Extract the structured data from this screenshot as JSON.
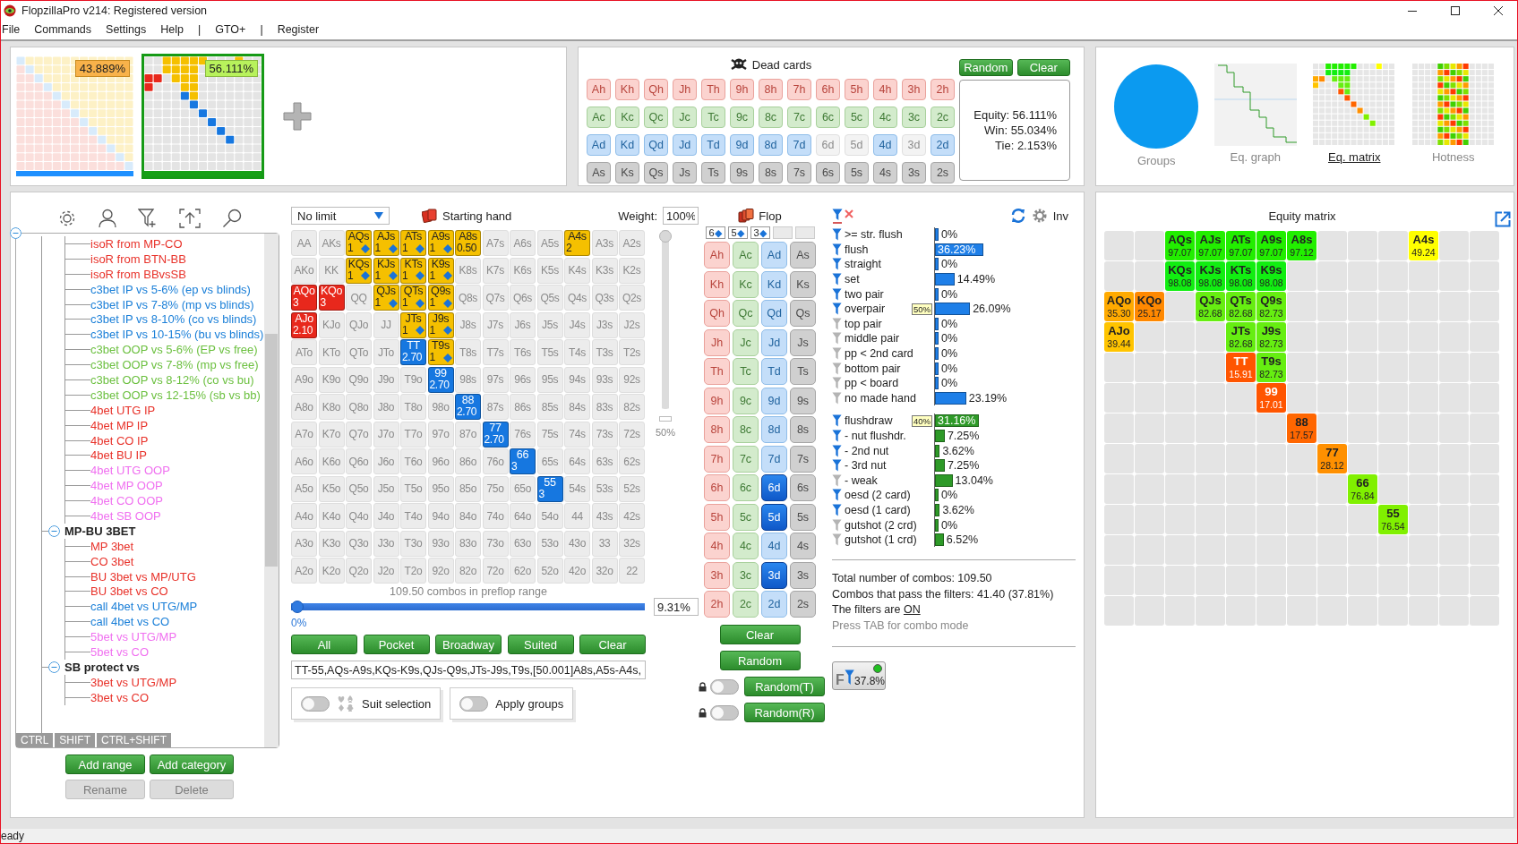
{
  "window": {
    "title": "FlopzillaPro v214: Registered version"
  },
  "menu": [
    "File",
    "Commands",
    "Settings",
    "Help",
    "|",
    "GTO+",
    "|",
    "Register"
  ],
  "ranges": [
    {
      "equity": "43.889%",
      "selected": false,
      "color": "#1e90ff"
    },
    {
      "equity": "56.111%",
      "selected": true,
      "color": "#16a016"
    }
  ],
  "dead_cards": {
    "title": "Dead cards",
    "buttons": [
      "Random",
      "Clear"
    ],
    "rows": [
      {
        "kind": "hearts",
        "cards": [
          {
            "card": "Ah",
            "disabled": false
          },
          {
            "card": "Kh",
            "disabled": false
          },
          {
            "card": "Qh",
            "disabled": false
          },
          {
            "card": "Jh",
            "disabled": false
          },
          {
            "card": "Th",
            "disabled": false
          },
          {
            "card": "9h",
            "disabled": false
          },
          {
            "card": "8h",
            "disabled": false
          },
          {
            "card": "7h",
            "disabled": false
          },
          {
            "card": "6h",
            "disabled": false
          },
          {
            "card": "5h",
            "disabled": false
          },
          {
            "card": "4h",
            "disabled": false
          },
          {
            "card": "3h",
            "disabled": false
          },
          {
            "card": "2h",
            "disabled": false
          }
        ]
      },
      {
        "kind": "clubs",
        "cards": [
          {
            "card": "Ac",
            "disabled": false
          },
          {
            "card": "Kc",
            "disabled": false
          },
          {
            "card": "Qc",
            "disabled": false
          },
          {
            "card": "Jc",
            "disabled": false
          },
          {
            "card": "Tc",
            "disabled": false
          },
          {
            "card": "9c",
            "disabled": false
          },
          {
            "card": "8c",
            "disabled": false
          },
          {
            "card": "7c",
            "disabled": false
          },
          {
            "card": "6c",
            "disabled": false
          },
          {
            "card": "5c",
            "disabled": false
          },
          {
            "card": "4c",
            "disabled": false
          },
          {
            "card": "3c",
            "disabled": false
          },
          {
            "card": "2c",
            "disabled": false
          }
        ]
      },
      {
        "kind": "diamonds",
        "cards": [
          {
            "card": "Ad",
            "disabled": false
          },
          {
            "card": "Kd",
            "disabled": false
          },
          {
            "card": "Qd",
            "disabled": false
          },
          {
            "card": "Jd",
            "disabled": false
          },
          {
            "card": "Td",
            "disabled": false
          },
          {
            "card": "9d",
            "disabled": false
          },
          {
            "card": "8d",
            "disabled": false
          },
          {
            "card": "7d",
            "disabled": false
          },
          {
            "card": "6d",
            "disabled": true
          },
          {
            "card": "5d",
            "disabled": true
          },
          {
            "card": "4d",
            "disabled": false
          },
          {
            "card": "3d",
            "disabled": true
          },
          {
            "card": "2d",
            "disabled": false
          }
        ]
      },
      {
        "kind": "spades",
        "cards": [
          {
            "card": "As",
            "disabled": false
          },
          {
            "card": "Ks",
            "disabled": false
          },
          {
            "card": "Qs",
            "disabled": false
          },
          {
            "card": "Js",
            "disabled": false
          },
          {
            "card": "Ts",
            "disabled": false
          },
          {
            "card": "9s",
            "disabled": false
          },
          {
            "card": "8s",
            "disabled": false
          },
          {
            "card": "7s",
            "disabled": false
          },
          {
            "card": "6s",
            "disabled": false
          },
          {
            "card": "5s",
            "disabled": false
          },
          {
            "card": "4s",
            "disabled": false
          },
          {
            "card": "3s",
            "disabled": false
          },
          {
            "card": "2s",
            "disabled": false
          }
        ]
      }
    ]
  },
  "equity": {
    "equity": "Equity: 56.111%",
    "win": "Win: 55.034%",
    "tie": "Tie: 2.153%"
  },
  "views": [
    {
      "label": "Groups",
      "kind": "groups",
      "selected": false
    },
    {
      "label": "Eq. graph",
      "kind": "graph",
      "selected": false
    },
    {
      "label": "Eq. matrix",
      "kind": "matrix",
      "selected": true
    },
    {
      "label": "Hotness",
      "kind": "hotness",
      "selected": false
    }
  ],
  "tree": {
    "expanded": true,
    "children": [
      {
        "children": [
          {
            "label": "isoR from MP-CO",
            "color": "#e8322a"
          },
          {
            "label": "isoR from BTN-BB",
            "color": "#e8322a"
          },
          {
            "label": "isoR from BBvsSB",
            "color": "#e8322a"
          },
          {
            "label": "c3bet IP vs 5-6% (ep vs blinds)",
            "color": "#1a7fd8"
          },
          {
            "label": "c3bet IP vs 7-8% (mp vs blinds)",
            "color": "#1a7fd8"
          },
          {
            "label": "c3bet IP vs 8-10% (co vs blinds)",
            "color": "#1a7fd8"
          },
          {
            "label": "c3bet IP vs 10-15% (bu vs blinds)",
            "color": "#1a7fd8"
          },
          {
            "label": "c3bet OOP vs 5-6% (EP vs free)",
            "color": "#6cc040"
          },
          {
            "label": "c3bet OOP vs 7-8% (mp vs free)",
            "color": "#6cc040"
          },
          {
            "label": "c3bet OOP vs 8-12% (co vs bu)",
            "color": "#6cc040"
          },
          {
            "label": "c3bet OOP vs 12-15% (sb vs bb)",
            "color": "#6cc040"
          },
          {
            "label": "4bet UTG IP",
            "color": "#e8322a"
          },
          {
            "label": "4bet MP IP",
            "color": "#e8322a"
          },
          {
            "label": "4bet CO IP",
            "color": "#e8322a"
          },
          {
            "label": "4bet BU IP",
            "color": "#e8322a"
          },
          {
            "label": "4bet UTG OOP",
            "color": "#f070f0"
          },
          {
            "label": "4bet MP OOP",
            "color": "#f070f0"
          },
          {
            "label": "4bet CO OOP",
            "color": "#f070f0"
          },
          {
            "label": "4bet SB OOP",
            "color": "#f070f0"
          }
        ]
      },
      {
        "label": "MP-BU 3BET",
        "expanded": true,
        "children": [
          {
            "label": "MP 3bet",
            "color": "#e8322a"
          },
          {
            "label": "CO 3bet",
            "color": "#e8322a"
          },
          {
            "label": "BU 3bet vs MP/UTG",
            "color": "#e8322a"
          },
          {
            "label": "BU 3bet vs CO",
            "color": "#e8322a"
          },
          {
            "label": "call 4bet vs UTG/MP",
            "color": "#1a7fd8"
          },
          {
            "label": "call 4bet vs CO",
            "color": "#1a7fd8"
          },
          {
            "label": "5bet vs UTG/MP",
            "color": "#f070f0"
          },
          {
            "label": "5bet vs CO",
            "color": "#f070f0"
          }
        ]
      },
      {
        "label": "SB protect vs",
        "expanded": true,
        "children": [
          {
            "label": "3bet vs UTG/MP",
            "color": "#e8322a"
          },
          {
            "label": "3bet vs CO",
            "color": "#e8322a"
          }
        ]
      }
    ]
  },
  "tree_modifiers": [
    "CTRL",
    "SHIFT",
    "CTRL+SHIFT"
  ],
  "tree_buttons": [
    {
      "label": "Add range",
      "disabled": false
    },
    {
      "label": "Add category",
      "disabled": false
    },
    {
      "label": "Rename",
      "disabled": true
    },
    {
      "label": "Delete",
      "disabled": true
    }
  ],
  "hand_panel": {
    "game": "No limit",
    "title": "Starting hand",
    "weight_label": "Weight:",
    "weight": "100%",
    "weight_slider": {
      "level": 1
    },
    "weight_mark": "50%",
    "combos": "109.50 combos in preflop range",
    "range_slider": {
      "level": 0
    },
    "range_min": "0%",
    "range_value": "9.31%",
    "buttons": [
      "All",
      "Pocket",
      "Broadway",
      "Suited",
      "Clear"
    ],
    "range_text": "TT-55,AQs-A9s,KQs-K9s,QJs-Q9s,JTs-J9s,T9s,[50.001]A8s,A5s-A4s,",
    "toggles": [
      {
        "label": "Suit selection",
        "kind": "suits",
        "on": false
      },
      {
        "label": "Apply groups",
        "kind": "plain",
        "on": false
      }
    ]
  },
  "hand_matrix": [
    [
      {
        "hand": "AA"
      },
      {
        "hand": "AKs"
      },
      {
        "hand": "AQs",
        "weight": "1",
        "color": "#f5c000",
        "suit_icon": true
      },
      {
        "hand": "AJs",
        "weight": "1",
        "color": "#f5c000",
        "suit_icon": true
      },
      {
        "hand": "ATs",
        "weight": "1",
        "color": "#f5c000",
        "suit_icon": true
      },
      {
        "hand": "A9s",
        "weight": "1",
        "color": "#f5c000",
        "suit_icon": true
      },
      {
        "hand": "A8s",
        "weight": "0.50",
        "color": "#f5c000",
        "suit_icon": false
      },
      {
        "hand": "A7s"
      },
      {
        "hand": "A6s"
      },
      {
        "hand": "A5s"
      },
      {
        "hand": "A4s",
        "weight": "2",
        "color": "#f5c000",
        "suit_icon": false
      },
      {
        "hand": "A3s"
      },
      {
        "hand": "A2s"
      }
    ],
    [
      {
        "hand": "AKo"
      },
      {
        "hand": "KK"
      },
      {
        "hand": "KQs",
        "weight": "1",
        "color": "#f5c000",
        "suit_icon": true
      },
      {
        "hand": "KJs",
        "weight": "1",
        "color": "#f5c000",
        "suit_icon": true
      },
      {
        "hand": "KTs",
        "weight": "1",
        "color": "#f5c000",
        "suit_icon": true
      },
      {
        "hand": "K9s",
        "weight": "1",
        "color": "#f5c000",
        "suit_icon": true
      },
      {
        "hand": "K8s"
      },
      {
        "hand": "K7s"
      },
      {
        "hand": "K6s"
      },
      {
        "hand": "K5s"
      },
      {
        "hand": "K4s"
      },
      {
        "hand": "K3s"
      },
      {
        "hand": "K2s"
      }
    ],
    [
      {
        "hand": "AQo",
        "weight": "3",
        "color": "#e8281c",
        "suit_icon": false
      },
      {
        "hand": "KQo",
        "weight": "3",
        "color": "#e8281c",
        "suit_icon": false
      },
      {
        "hand": "QQ"
      },
      {
        "hand": "QJs",
        "weight": "1",
        "color": "#f5c000",
        "suit_icon": true
      },
      {
        "hand": "QTs",
        "weight": "1",
        "color": "#f5c000",
        "suit_icon": true
      },
      {
        "hand": "Q9s",
        "weight": "1",
        "color": "#f5c000",
        "suit_icon": true
      },
      {
        "hand": "Q8s"
      },
      {
        "hand": "Q7s"
      },
      {
        "hand": "Q6s"
      },
      {
        "hand": "Q5s"
      },
      {
        "hand": "Q4s"
      },
      {
        "hand": "Q3s"
      },
      {
        "hand": "Q2s"
      }
    ],
    [
      {
        "hand": "AJo",
        "weight": "2.10",
        "color": "#e8281c",
        "suit_icon": false
      },
      {
        "hand": "KJo"
      },
      {
        "hand": "QJo"
      },
      {
        "hand": "JJ"
      },
      {
        "hand": "JTs",
        "weight": "1",
        "color": "#f5c000",
        "suit_icon": true
      },
      {
        "hand": "J9s",
        "weight": "1",
        "color": "#f5c000",
        "suit_icon": true
      },
      {
        "hand": "J8s"
      },
      {
        "hand": "J7s"
      },
      {
        "hand": "J6s"
      },
      {
        "hand": "J5s"
      },
      {
        "hand": "J4s"
      },
      {
        "hand": "J3s"
      },
      {
        "hand": "J2s"
      }
    ],
    [
      {
        "hand": "ATo"
      },
      {
        "hand": "KTo"
      },
      {
        "hand": "QTo"
      },
      {
        "hand": "JTo"
      },
      {
        "hand": "TT",
        "weight": "2.70",
        "color": "#1677e0",
        "suit_icon": false
      },
      {
        "hand": "T9s",
        "weight": "1",
        "color": "#f5c000",
        "suit_icon": true
      },
      {
        "hand": "T8s"
      },
      {
        "hand": "T7s"
      },
      {
        "hand": "T6s"
      },
      {
        "hand": "T5s"
      },
      {
        "hand": "T4s"
      },
      {
        "hand": "T3s"
      },
      {
        "hand": "T2s"
      }
    ],
    [
      {
        "hand": "A9o"
      },
      {
        "hand": "K9o"
      },
      {
        "hand": "Q9o"
      },
      {
        "hand": "J9o"
      },
      {
        "hand": "T9o"
      },
      {
        "hand": "99",
        "weight": "2.70",
        "color": "#1677e0",
        "suit_icon": false
      },
      {
        "hand": "98s"
      },
      {
        "hand": "97s"
      },
      {
        "hand": "96s"
      },
      {
        "hand": "95s"
      },
      {
        "hand": "94s"
      },
      {
        "hand": "93s"
      },
      {
        "hand": "92s"
      }
    ],
    [
      {
        "hand": "A8o"
      },
      {
        "hand": "K8o"
      },
      {
        "hand": "Q8o"
      },
      {
        "hand": "J8o"
      },
      {
        "hand": "T8o"
      },
      {
        "hand": "98o"
      },
      {
        "hand": "88",
        "weight": "2.70",
        "color": "#1677e0",
        "suit_icon": false
      },
      {
        "hand": "87s"
      },
      {
        "hand": "86s"
      },
      {
        "hand": "85s"
      },
      {
        "hand": "84s"
      },
      {
        "hand": "83s"
      },
      {
        "hand": "82s"
      }
    ],
    [
      {
        "hand": "A7o"
      },
      {
        "hand": "K7o"
      },
      {
        "hand": "Q7o"
      },
      {
        "hand": "J7o"
      },
      {
        "hand": "T7o"
      },
      {
        "hand": "97o"
      },
      {
        "hand": "87o"
      },
      {
        "hand": "77",
        "weight": "2.70",
        "color": "#1677e0",
        "suit_icon": false
      },
      {
        "hand": "76s"
      },
      {
        "hand": "75s"
      },
      {
        "hand": "74s"
      },
      {
        "hand": "73s"
      },
      {
        "hand": "72s"
      }
    ],
    [
      {
        "hand": "A6o"
      },
      {
        "hand": "K6o"
      },
      {
        "hand": "Q6o"
      },
      {
        "hand": "J6o"
      },
      {
        "hand": "T6o"
      },
      {
        "hand": "96o"
      },
      {
        "hand": "86o"
      },
      {
        "hand": "76o"
      },
      {
        "hand": "66",
        "weight": "3",
        "color": "#1677e0",
        "suit_icon": false
      },
      {
        "hand": "65s"
      },
      {
        "hand": "64s"
      },
      {
        "hand": "63s"
      },
      {
        "hand": "62s"
      }
    ],
    [
      {
        "hand": "A5o"
      },
      {
        "hand": "K5o"
      },
      {
        "hand": "Q5o"
      },
      {
        "hand": "J5o"
      },
      {
        "hand": "T5o"
      },
      {
        "hand": "95o"
      },
      {
        "hand": "85o"
      },
      {
        "hand": "75o"
      },
      {
        "hand": "65o"
      },
      {
        "hand": "55",
        "weight": "3",
        "color": "#1677e0",
        "suit_icon": false
      },
      {
        "hand": "54s"
      },
      {
        "hand": "53s"
      },
      {
        "hand": "52s"
      }
    ],
    [
      {
        "hand": "A4o"
      },
      {
        "hand": "K4o"
      },
      {
        "hand": "Q4o"
      },
      {
        "hand": "J4o"
      },
      {
        "hand": "T4o"
      },
      {
        "hand": "94o"
      },
      {
        "hand": "84o"
      },
      {
        "hand": "74o"
      },
      {
        "hand": "64o"
      },
      {
        "hand": "54o"
      },
      {
        "hand": "44"
      },
      {
        "hand": "43s"
      },
      {
        "hand": "42s"
      }
    ],
    [
      {
        "hand": "A3o"
      },
      {
        "hand": "K3o"
      },
      {
        "hand": "Q3o"
      },
      {
        "hand": "J3o"
      },
      {
        "hand": "T3o"
      },
      {
        "hand": "93o"
      },
      {
        "hand": "83o"
      },
      {
        "hand": "73o"
      },
      {
        "hand": "63o"
      },
      {
        "hand": "53o"
      },
      {
        "hand": "43o"
      },
      {
        "hand": "33"
      },
      {
        "hand": "32s"
      }
    ],
    [
      {
        "hand": "A2o"
      },
      {
        "hand": "K2o"
      },
      {
        "hand": "Q2o"
      },
      {
        "hand": "J2o"
      },
      {
        "hand": "T2o"
      },
      {
        "hand": "92o"
      },
      {
        "hand": "82o"
      },
      {
        "hand": "72o"
      },
      {
        "hand": "62o"
      },
      {
        "hand": "52o"
      },
      {
        "hand": "42o"
      },
      {
        "hand": "32o"
      },
      {
        "hand": "22"
      }
    ]
  ],
  "flop": {
    "title": "Flop",
    "slots": [
      {
        "rank": "6",
        "suit": "◆",
        "filled": true
      },
      {
        "rank": "5",
        "suit": "◆",
        "filled": true
      },
      {
        "rank": "3",
        "suit": "◆",
        "filled": true
      },
      {
        "filled": false
      },
      {
        "filled": false
      }
    ],
    "columns": [
      {
        "kind": "hearts",
        "cards": [
          {
            "card": "Ah",
            "selected": false
          },
          {
            "card": "Kh",
            "selected": false
          },
          {
            "card": "Qh",
            "selected": false
          },
          {
            "card": "Jh",
            "selected": false
          },
          {
            "card": "Th",
            "selected": false
          },
          {
            "card": "9h",
            "selected": false
          },
          {
            "card": "8h",
            "selected": false
          },
          {
            "card": "7h",
            "selected": false
          },
          {
            "card": "6h",
            "selected": false
          },
          {
            "card": "5h",
            "selected": false
          },
          {
            "card": "4h",
            "selected": false
          },
          {
            "card": "3h",
            "selected": false
          },
          {
            "card": "2h",
            "selected": false
          }
        ]
      },
      {
        "kind": "clubs",
        "cards": [
          {
            "card": "Ac",
            "selected": false
          },
          {
            "card": "Kc",
            "selected": false
          },
          {
            "card": "Qc",
            "selected": false
          },
          {
            "card": "Jc",
            "selected": false
          },
          {
            "card": "Tc",
            "selected": false
          },
          {
            "card": "9c",
            "selected": false
          },
          {
            "card": "8c",
            "selected": false
          },
          {
            "card": "7c",
            "selected": false
          },
          {
            "card": "6c",
            "selected": false
          },
          {
            "card": "5c",
            "selected": false
          },
          {
            "card": "4c",
            "selected": false
          },
          {
            "card": "3c",
            "selected": false
          },
          {
            "card": "2c",
            "selected": false
          }
        ]
      },
      {
        "kind": "diamonds",
        "cards": [
          {
            "card": "Ad",
            "selected": false
          },
          {
            "card": "Kd",
            "selected": false
          },
          {
            "card": "Qd",
            "selected": false
          },
          {
            "card": "Jd",
            "selected": false
          },
          {
            "card": "Td",
            "selected": false
          },
          {
            "card": "9d",
            "selected": false
          },
          {
            "card": "8d",
            "selected": false
          },
          {
            "card": "7d",
            "selected": false
          },
          {
            "card": "6d",
            "selected": true
          },
          {
            "card": "5d",
            "selected": true
          },
          {
            "card": "4d",
            "selected": false
          },
          {
            "card": "3d",
            "selected": true
          },
          {
            "card": "2d",
            "selected": false
          }
        ]
      },
      {
        "kind": "spades",
        "cards": [
          {
            "card": "As",
            "selected": false
          },
          {
            "card": "Ks",
            "selected": false
          },
          {
            "card": "Qs",
            "selected": false
          },
          {
            "card": "Js",
            "selected": false
          },
          {
            "card": "Ts",
            "selected": false
          },
          {
            "card": "9s",
            "selected": false
          },
          {
            "card": "8s",
            "selected": false
          },
          {
            "card": "7s",
            "selected": false
          },
          {
            "card": "6s",
            "selected": false
          },
          {
            "card": "5s",
            "selected": false
          },
          {
            "card": "4s",
            "selected": false
          },
          {
            "card": "3s",
            "selected": false
          },
          {
            "card": "2s",
            "selected": false
          }
        ]
      }
    ],
    "buttons": [
      {
        "label": "Clear",
        "kind": "plain"
      },
      {
        "label": "Random",
        "kind": "plain"
      },
      {
        "label": "Random(T)",
        "kind": "lockable",
        "locked": false
      },
      {
        "label": "Random(R)",
        "kind": "lockable",
        "locked": false
      }
    ]
  },
  "filters": {
    "inv": "Inv",
    "sections": [
      {
        "color": "#1e7fe8",
        "items": [
          {
            "label": ">= str. flush",
            "active": true,
            "value": "0%",
            "level": 0,
            "selected": false
          },
          {
            "label": "flush",
            "active": true,
            "value": "36.23%",
            "level": 0.3623,
            "selected": true
          },
          {
            "label": "straight",
            "active": true,
            "value": "0%",
            "level": 0,
            "selected": false
          },
          {
            "label": "set",
            "active": true,
            "value": "14.49%",
            "level": 0.1449,
            "selected": false
          },
          {
            "label": "two pair",
            "active": true,
            "value": "0%",
            "level": 0,
            "selected": false
          },
          {
            "label": "overpair",
            "active": true,
            "badge": "50%",
            "value": "26.09%",
            "level": 0.2609,
            "selected": false
          },
          {
            "label": "top pair",
            "active": false,
            "value": "0%",
            "level": 0,
            "selected": false
          },
          {
            "label": "middle pair",
            "active": false,
            "value": "0%",
            "level": 0,
            "selected": false
          },
          {
            "label": "pp < 2nd card",
            "active": false,
            "value": "0%",
            "level": 0,
            "selected": false
          },
          {
            "label": "bottom pair",
            "active": false,
            "value": "0%",
            "level": 0,
            "selected": false
          },
          {
            "label": "pp < board",
            "active": false,
            "value": "0%",
            "level": 0,
            "selected": false
          },
          {
            "label": "no made hand",
            "active": false,
            "value": "23.19%",
            "level": 0.2319,
            "selected": false
          }
        ]
      },
      {
        "color": "#2e9a28",
        "items": [
          {
            "label": "flushdraw",
            "active": true,
            "badge": "40%",
            "value": "31.16%",
            "level": 0.3116,
            "selected": true
          },
          {
            "label": "- nut flushdr.",
            "active": true,
            "value": "7.25%",
            "level": 0.0725,
            "selected": false
          },
          {
            "label": "- 2nd nut",
            "active": true,
            "value": "3.62%",
            "level": 0.0362,
            "selected": false
          },
          {
            "label": "- 3rd nut",
            "active": true,
            "value": "7.25%",
            "level": 0.0725,
            "selected": false
          },
          {
            "label": "- weak",
            "active": false,
            "value": "13.04%",
            "level": 0.1304,
            "selected": false
          },
          {
            "label": "oesd (2 card)",
            "active": true,
            "value": "0%",
            "level": 0,
            "selected": false
          },
          {
            "label": "oesd (1 card)",
            "active": true,
            "value": "3.62%",
            "level": 0.0362,
            "selected": false
          },
          {
            "label": "gutshot (2 crd)",
            "active": false,
            "value": "0%",
            "level": 0,
            "selected": false
          },
          {
            "label": "gutshot (1 crd)",
            "active": false,
            "value": "6.52%",
            "level": 0.0652,
            "selected": false
          }
        ]
      }
    ],
    "stats": {
      "total": "Total number of combos: 109.50",
      "passing": "Combos that pass the filters: 41.40 (37.81%)",
      "filters_label": "The filters are",
      "filters_state": "ON",
      "hint": "Press TAB for combo mode"
    },
    "filter_button": {
      "letter": "F",
      "value": "37.8%",
      "on": true
    }
  },
  "equity_matrix": {
    "title": "Equity matrix",
    "rows": [
      [
        null,
        null,
        {
          "hand": "AQs",
          "equity": "97.07",
          "color": "#22ee00"
        },
        {
          "hand": "AJs",
          "equity": "97.07",
          "color": "#22ee00"
        },
        {
          "hand": "ATs",
          "equity": "97.07",
          "color": "#22ee00"
        },
        {
          "hand": "A9s",
          "equity": "97.07",
          "color": "#22ee00"
        },
        {
          "hand": "A8s",
          "equity": "97.12",
          "color": "#22ee00"
        },
        null,
        null,
        null,
        {
          "hand": "A4s",
          "equity": "49.24",
          "color": "#ffff00"
        },
        null,
        null
      ],
      [
        null,
        null,
        {
          "hand": "KQs",
          "equity": "98.08",
          "color": "#11ee11"
        },
        {
          "hand": "KJs",
          "equity": "98.08",
          "color": "#11ee11"
        },
        {
          "hand": "KTs",
          "equity": "98.08",
          "color": "#11ee11"
        },
        {
          "hand": "K9s",
          "equity": "98.08",
          "color": "#11ee11"
        },
        null,
        null,
        null,
        null,
        null,
        null,
        null
      ],
      [
        {
          "hand": "AQo",
          "equity": "35.30",
          "color": "#ffaa00"
        },
        {
          "hand": "KQo",
          "equity": "25.17",
          "color": "#ff8800"
        },
        null,
        {
          "hand": "QJs",
          "equity": "82.68",
          "color": "#66ee11"
        },
        {
          "hand": "QTs",
          "equity": "82.68",
          "color": "#66ee11"
        },
        {
          "hand": "Q9s",
          "equity": "82.73",
          "color": "#66ee11"
        },
        null,
        null,
        null,
        null,
        null,
        null,
        null
      ],
      [
        {
          "hand": "AJo",
          "equity": "39.44",
          "color": "#ffc400"
        },
        null,
        null,
        null,
        {
          "hand": "JTs",
          "equity": "82.68",
          "color": "#66ee11"
        },
        {
          "hand": "J9s",
          "equity": "82.73",
          "color": "#66ee11"
        },
        null,
        null,
        null,
        null,
        null,
        null,
        null
      ],
      [
        null,
        null,
        null,
        null,
        {
          "hand": "TT",
          "equity": "15.91",
          "color": "#ff5500"
        },
        {
          "hand": "T9s",
          "equity": "82.73",
          "color": "#66ee11"
        },
        null,
        null,
        null,
        null,
        null,
        null,
        null
      ],
      [
        null,
        null,
        null,
        null,
        null,
        {
          "hand": "99",
          "equity": "17.01",
          "color": "#ff5500"
        },
        null,
        null,
        null,
        null,
        null,
        null,
        null
      ],
      [
        null,
        null,
        null,
        null,
        null,
        null,
        {
          "hand": "88",
          "equity": "17.57",
          "color": "#ff6600"
        },
        null,
        null,
        null,
        null,
        null,
        null
      ],
      [
        null,
        null,
        null,
        null,
        null,
        null,
        null,
        {
          "hand": "77",
          "equity": "28.12",
          "color": "#ff9000"
        },
        null,
        null,
        null,
        null,
        null
      ],
      [
        null,
        null,
        null,
        null,
        null,
        null,
        null,
        null,
        {
          "hand": "66",
          "equity": "76.84",
          "color": "#80f000"
        },
        null,
        null,
        null,
        null
      ],
      [
        null,
        null,
        null,
        null,
        null,
        null,
        null,
        null,
        null,
        {
          "hand": "55",
          "equity": "76.54",
          "color": "#80f000"
        },
        null,
        null,
        null
      ],
      [
        null,
        null,
        null,
        null,
        null,
        null,
        null,
        null,
        null,
        null,
        null,
        null,
        null
      ],
      [
        null,
        null,
        null,
        null,
        null,
        null,
        null,
        null,
        null,
        null,
        null,
        null,
        null
      ],
      [
        null,
        null,
        null,
        null,
        null,
        null,
        null,
        null,
        null,
        null,
        null,
        null,
        null
      ]
    ]
  },
  "status_bar": "eady"
}
